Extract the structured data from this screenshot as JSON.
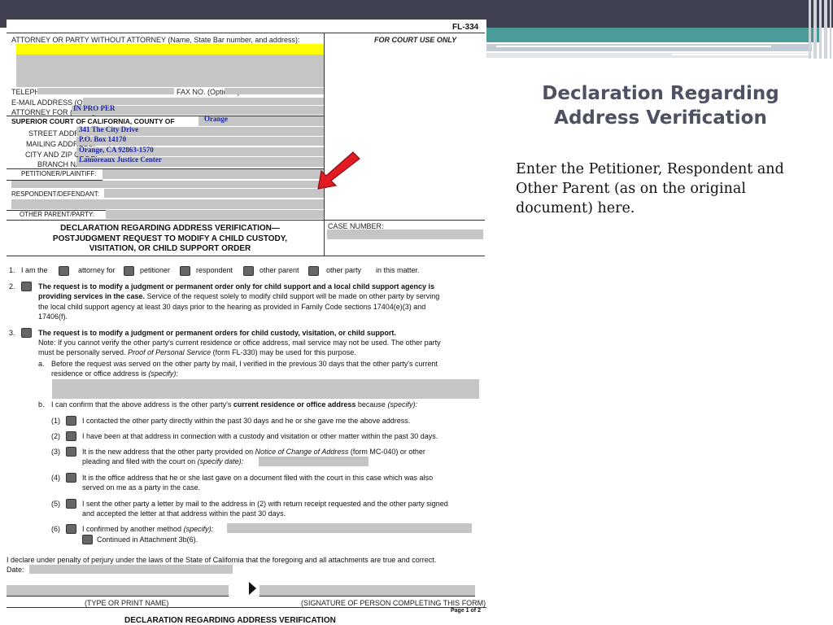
{
  "slide": {
    "title_line1": "Declaration Regarding",
    "title_line2": "Address Verification",
    "body": "Enter the Petitioner, Respondent and Other Parent (as on the original document) here."
  },
  "form": {
    "form_number": "FL-334",
    "attorney_header": "ATTORNEY OR PARTY WITHOUT ATTORNEY (Name, State Bar number, and address):",
    "court_use": "FOR COURT USE ONLY",
    "telephone": "TELEPHONE NO.:",
    "fax": "FAX NO. (Optional):",
    "email": "E-MAIL ADDRESS (Optional):",
    "attorney_for": "ATTORNEY FOR (Name):",
    "attorney_for_value": "IN PRO PER",
    "court": "SUPERIOR COURT OF CALIFORNIA, COUNTY OF",
    "county_value": "Orange",
    "street_label": "STREET ADDRESS:",
    "street_value": "341 The City Drive",
    "mailing_label": "MAILING ADDRESS:",
    "mailing_value": "P.O. Box 14170",
    "city_label": "CITY AND ZIP CODE:",
    "city_value": "Orange, CA 92863-1570",
    "branch_label": "BRANCH NAME:",
    "branch_value": "Lamoreaux Justice Center",
    "petitioner": "PETITIONER/PLAINTIFF:",
    "respondent": "RESPONDENT/DEFENDANT:",
    "other_parent": "OTHER PARENT/PARTY:",
    "doc_title_1": "DECLARATION REGARDING ADDRESS VERIFICATION—",
    "doc_title_2": "POSTJUDGMENT REQUEST TO MODIFY A CHILD CUSTODY,",
    "doc_title_3": "VISITATION, OR CHILD SUPPORT ORDER",
    "case_number": "CASE NUMBER:",
    "item1": {
      "num": "1.",
      "i_am_the": "I am the",
      "attorney_for": "attorney for",
      "petitioner": "petitioner",
      "respondent": "respondent",
      "other_parent": "other parent",
      "other_party": "other party",
      "in_this_matter": "in this matter."
    },
    "item2": {
      "num": "2.",
      "bold": "The request is to modify a judgment or permanent order only for child support and a local child support agency is",
      "bold2": "providing services in the case.",
      "rest": " Service of the request solely to modify child support will be made on other party by serving",
      "line3": "the local child support agency at least 30 days prior to the hearing as provided in Family Code sections 17404(e)(3) and",
      "line4": "17406(f)."
    },
    "item3": {
      "num": "3.",
      "bold": "The request is to modify a judgment or permanent orders for child custody, visitation, or child support.",
      "note1": "Note: If you cannot verify the other party's current residence or office address, mail service may not be used. The other party",
      "note2a": "must be personally served. ",
      "note2b": "Proof of Personal Service",
      "note2c": " (form FL-330) may be used for this purpose.",
      "a_label": "a.",
      "a1": "Before the request was served on the other party by mail, I verified in the previous 30 days that the other party's current",
      "a2a": "residence or office address is ",
      "a2b": "(specify):",
      "b_label": "b.",
      "b1a": "I can confirm that the above address is the other party's ",
      "b1b": "current residence or office address",
      "b1c": " because ",
      "b1d": "(specify):",
      "s1_num": "(1)",
      "s1": "I contacted the other party directly within the past 30 days and he or she gave me the above address.",
      "s2_num": "(2)",
      "s2": "I have been at that address in connection with a custody and visitation or other matter within the past 30 days.",
      "s3_num": "(3)",
      "s3a": "It is the new address that the other party provided on ",
      "s3b": "Notice of Change of Address",
      "s3c": " (form MC-040) or other",
      "s3d": "pleading and filed with the court on ",
      "s3e": "(specify date):",
      "s4_num": "(4)",
      "s4a": "It is the office address that he or she last gave on a document filed with the court in this case which was also",
      "s4b": "served on me as a party in the case.",
      "s5_num": "(5)",
      "s5a": "I sent the other party a letter by mail to the address in (2) with return receipt requested and the other party signed",
      "s5b": "and accepted the letter at that address within the past 30 days.",
      "s6_num": "(6)",
      "s6a": "I confirmed by another method ",
      "s6b": "(specify):",
      "s6c": "Continued in Attachment 3b(6)."
    },
    "declare": "I declare under penalty of perjury under the laws of the State of California that the foregoing and all attachments are true and correct.",
    "date": "Date:",
    "type_name": "(TYPE OR PRINT NAME)",
    "signature": "(SIGNATURE OF PERSON COMPLETING THIS FORM)",
    "page": "Page 1 of 2",
    "footer_cut": "DECLARATION REGARDING ADDRESS VERIFICATION"
  },
  "colors": {
    "topbar": "#3f4150",
    "teal": "#4a9c9b",
    "title": "#4d5161",
    "highlight": "#ffff00",
    "fill_blue": "#2027a5",
    "arrow": "#e21b23"
  },
  "icons": [
    "red-arrow-icon",
    "signature-arrow-icon",
    "checkbox-icon"
  ]
}
